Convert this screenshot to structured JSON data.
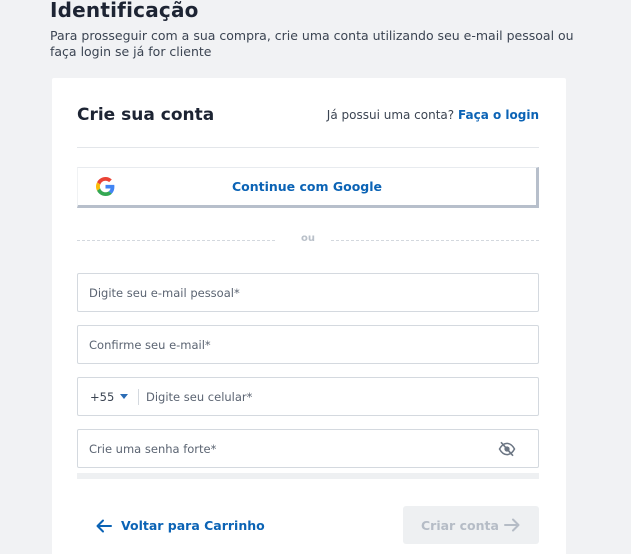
{
  "page": {
    "title": "Identificação",
    "subtitle": "Para prosseguir com a sua compra, crie uma conta utilizando seu e-mail pessoal ou faça login se já for cliente"
  },
  "card": {
    "title": "Crie sua conta",
    "login_prompt": "Já possui uma conta?",
    "login_link": "Faça o login"
  },
  "google": {
    "label": "Continue com Google",
    "icon": "google-icon"
  },
  "divider": {
    "label": "ou"
  },
  "form": {
    "email": {
      "value": "",
      "placeholder": "Digite seu e-mail pessoal*"
    },
    "confirm_email": {
      "value": "",
      "placeholder": "Confirme seu e-mail*"
    },
    "phone": {
      "country_code": "+55",
      "value": "",
      "placeholder": "Digite seu celular*"
    },
    "password": {
      "value": "",
      "placeholder": "Crie uma senha forte*",
      "toggle_icon": "eye-off-icon"
    }
  },
  "actions": {
    "back_label": "Voltar para Carrinho",
    "create_label": "Criar conta"
  },
  "colors": {
    "accent": "#0b63b5",
    "disabled_text": "#b5bcc6",
    "disabled_bg": "#eef0f2"
  }
}
